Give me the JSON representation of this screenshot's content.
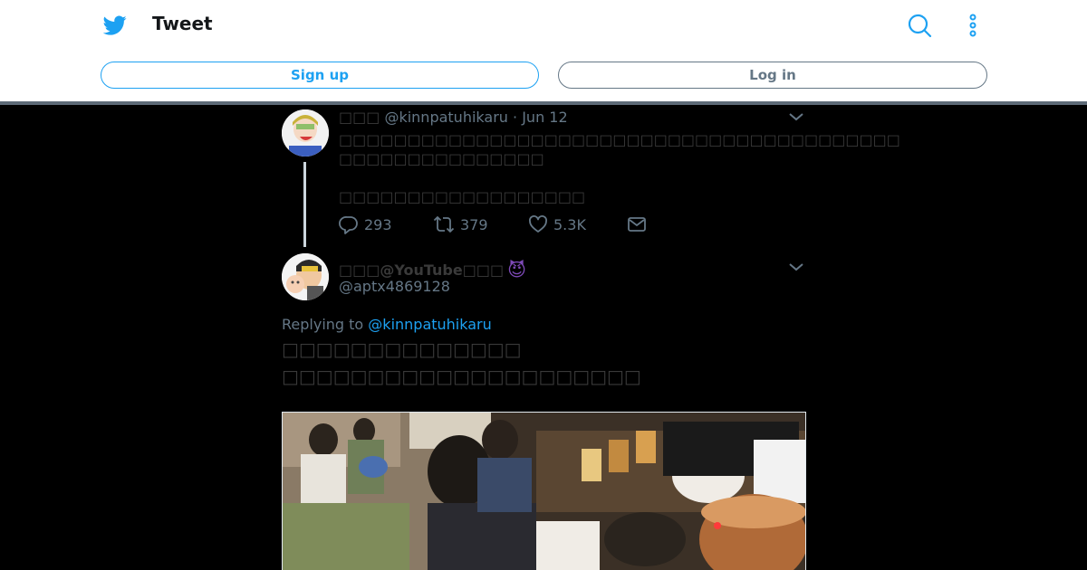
{
  "header": {
    "title": "Tweet",
    "signup_label": "Sign up",
    "login_label": "Log in",
    "icons": [
      "twitter-bird-icon",
      "search-icon",
      "more-vertical-icon"
    ]
  },
  "colors": {
    "accent": "#1da1f2",
    "muted": "#657786",
    "background": "#000000"
  },
  "tweet1": {
    "name": "□□□",
    "handle": "@kinnpatuhikaru",
    "date": "Jun 12",
    "text_line1": "□□□□□□□□□□□□□□□□□□□□□□□□□□□□□□□□□□□□□□□□□",
    "text_line2": "□□□□□□□□□□□□□□□",
    "text_line3": "□□□□□□□□□□□□□□□□□□",
    "replies": "293",
    "retweets": "379",
    "likes": "5.3K"
  },
  "tweet2": {
    "name_prefix": "□□□",
    "name_mid": "@YouTube",
    "name_suffix": "□□□",
    "emoji": "😈",
    "handle": "@aptx4869128",
    "replying_prefix": "Replying to",
    "replying_handle": "@kinnpatuhikaru",
    "text_line1": "□□□□□□□□□□□□□□",
    "text_line2": "□□□□□□□□□□□□□□□□□□□□□"
  }
}
